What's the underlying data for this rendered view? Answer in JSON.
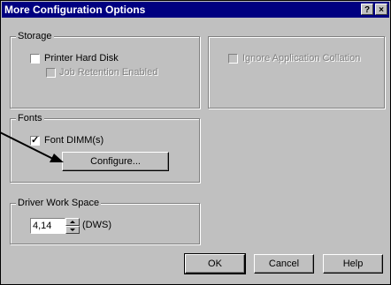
{
  "title": "More Configuration Options",
  "titlebar": {
    "help_glyph": "?",
    "close_glyph": "×"
  },
  "storage": {
    "legend": "Storage",
    "printer_hard_disk": {
      "label": "Printer Hard Disk",
      "checked": false
    },
    "job_retention": {
      "label": "Job Retention Enabled",
      "checked": false,
      "enabled": false
    }
  },
  "ignore_collation": {
    "label": "Ignore Application Collation",
    "checked": false,
    "enabled": false
  },
  "fonts": {
    "legend": "Fonts",
    "font_dimm": {
      "label": "Font DIMM(s)",
      "checked": true,
      "mark": "✓"
    },
    "configure_label": "Configure..."
  },
  "driver_work_space": {
    "legend": "Driver Work Space",
    "value": "4,14",
    "unit": "(DWS)"
  },
  "buttons": {
    "ok": "OK",
    "cancel": "Cancel",
    "help": "Help"
  }
}
